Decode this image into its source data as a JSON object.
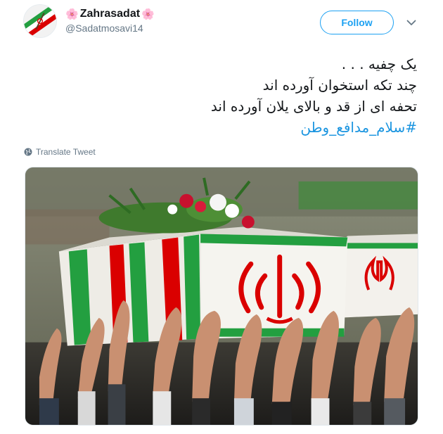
{
  "user": {
    "display_name": "Zahrasadat",
    "handle": "@Sadatmosavi14",
    "name_decoration": "🌸"
  },
  "actions": {
    "follow_label": "Follow"
  },
  "icons": {
    "menu": "chevron-down-icon",
    "translate": "globe-icon",
    "avatar": "flag-avatar"
  },
  "tweet": {
    "lines": [
      "یک چفیه  . . .",
      "چند تکه استخوان آورده اند",
      "تحفه  ای از قد و بالای یلان آورده اند"
    ],
    "hashtag": "#سلام_مدافع_وطن"
  },
  "translate_label": "Translate Tweet",
  "media": {
    "description_icon": "photo"
  },
  "colors": {
    "accent": "#1da1f2",
    "hashtag": "#1b95e0",
    "secondary_text": "#657786",
    "flag_green": "#239f40",
    "flag_red": "#da0000"
  }
}
